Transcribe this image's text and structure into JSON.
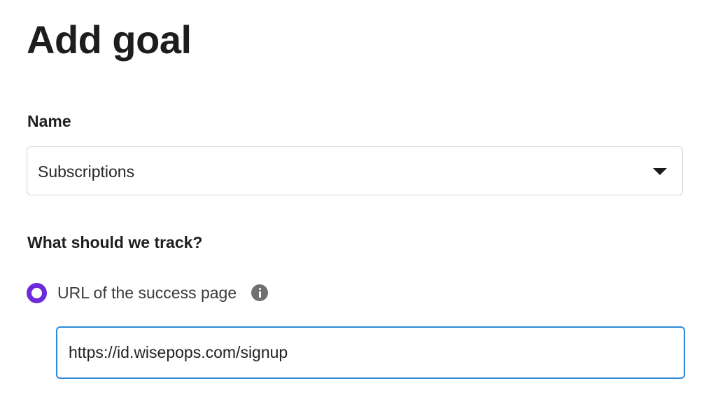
{
  "page": {
    "title": "Add goal"
  },
  "name_field": {
    "label": "Name",
    "selected_value": "Subscriptions",
    "caret_icon": "caret-down-icon"
  },
  "track_section": {
    "label": "What should we track?",
    "options": [
      {
        "label": "URL of the success page",
        "selected": true,
        "info_icon": "info-icon"
      }
    ],
    "url_input": {
      "value": "https://id.wisepops.com/signup"
    }
  },
  "colors": {
    "accent_radio": "#6c2bd9",
    "focus_border": "#2f8ad8",
    "info_icon": "#707070"
  }
}
